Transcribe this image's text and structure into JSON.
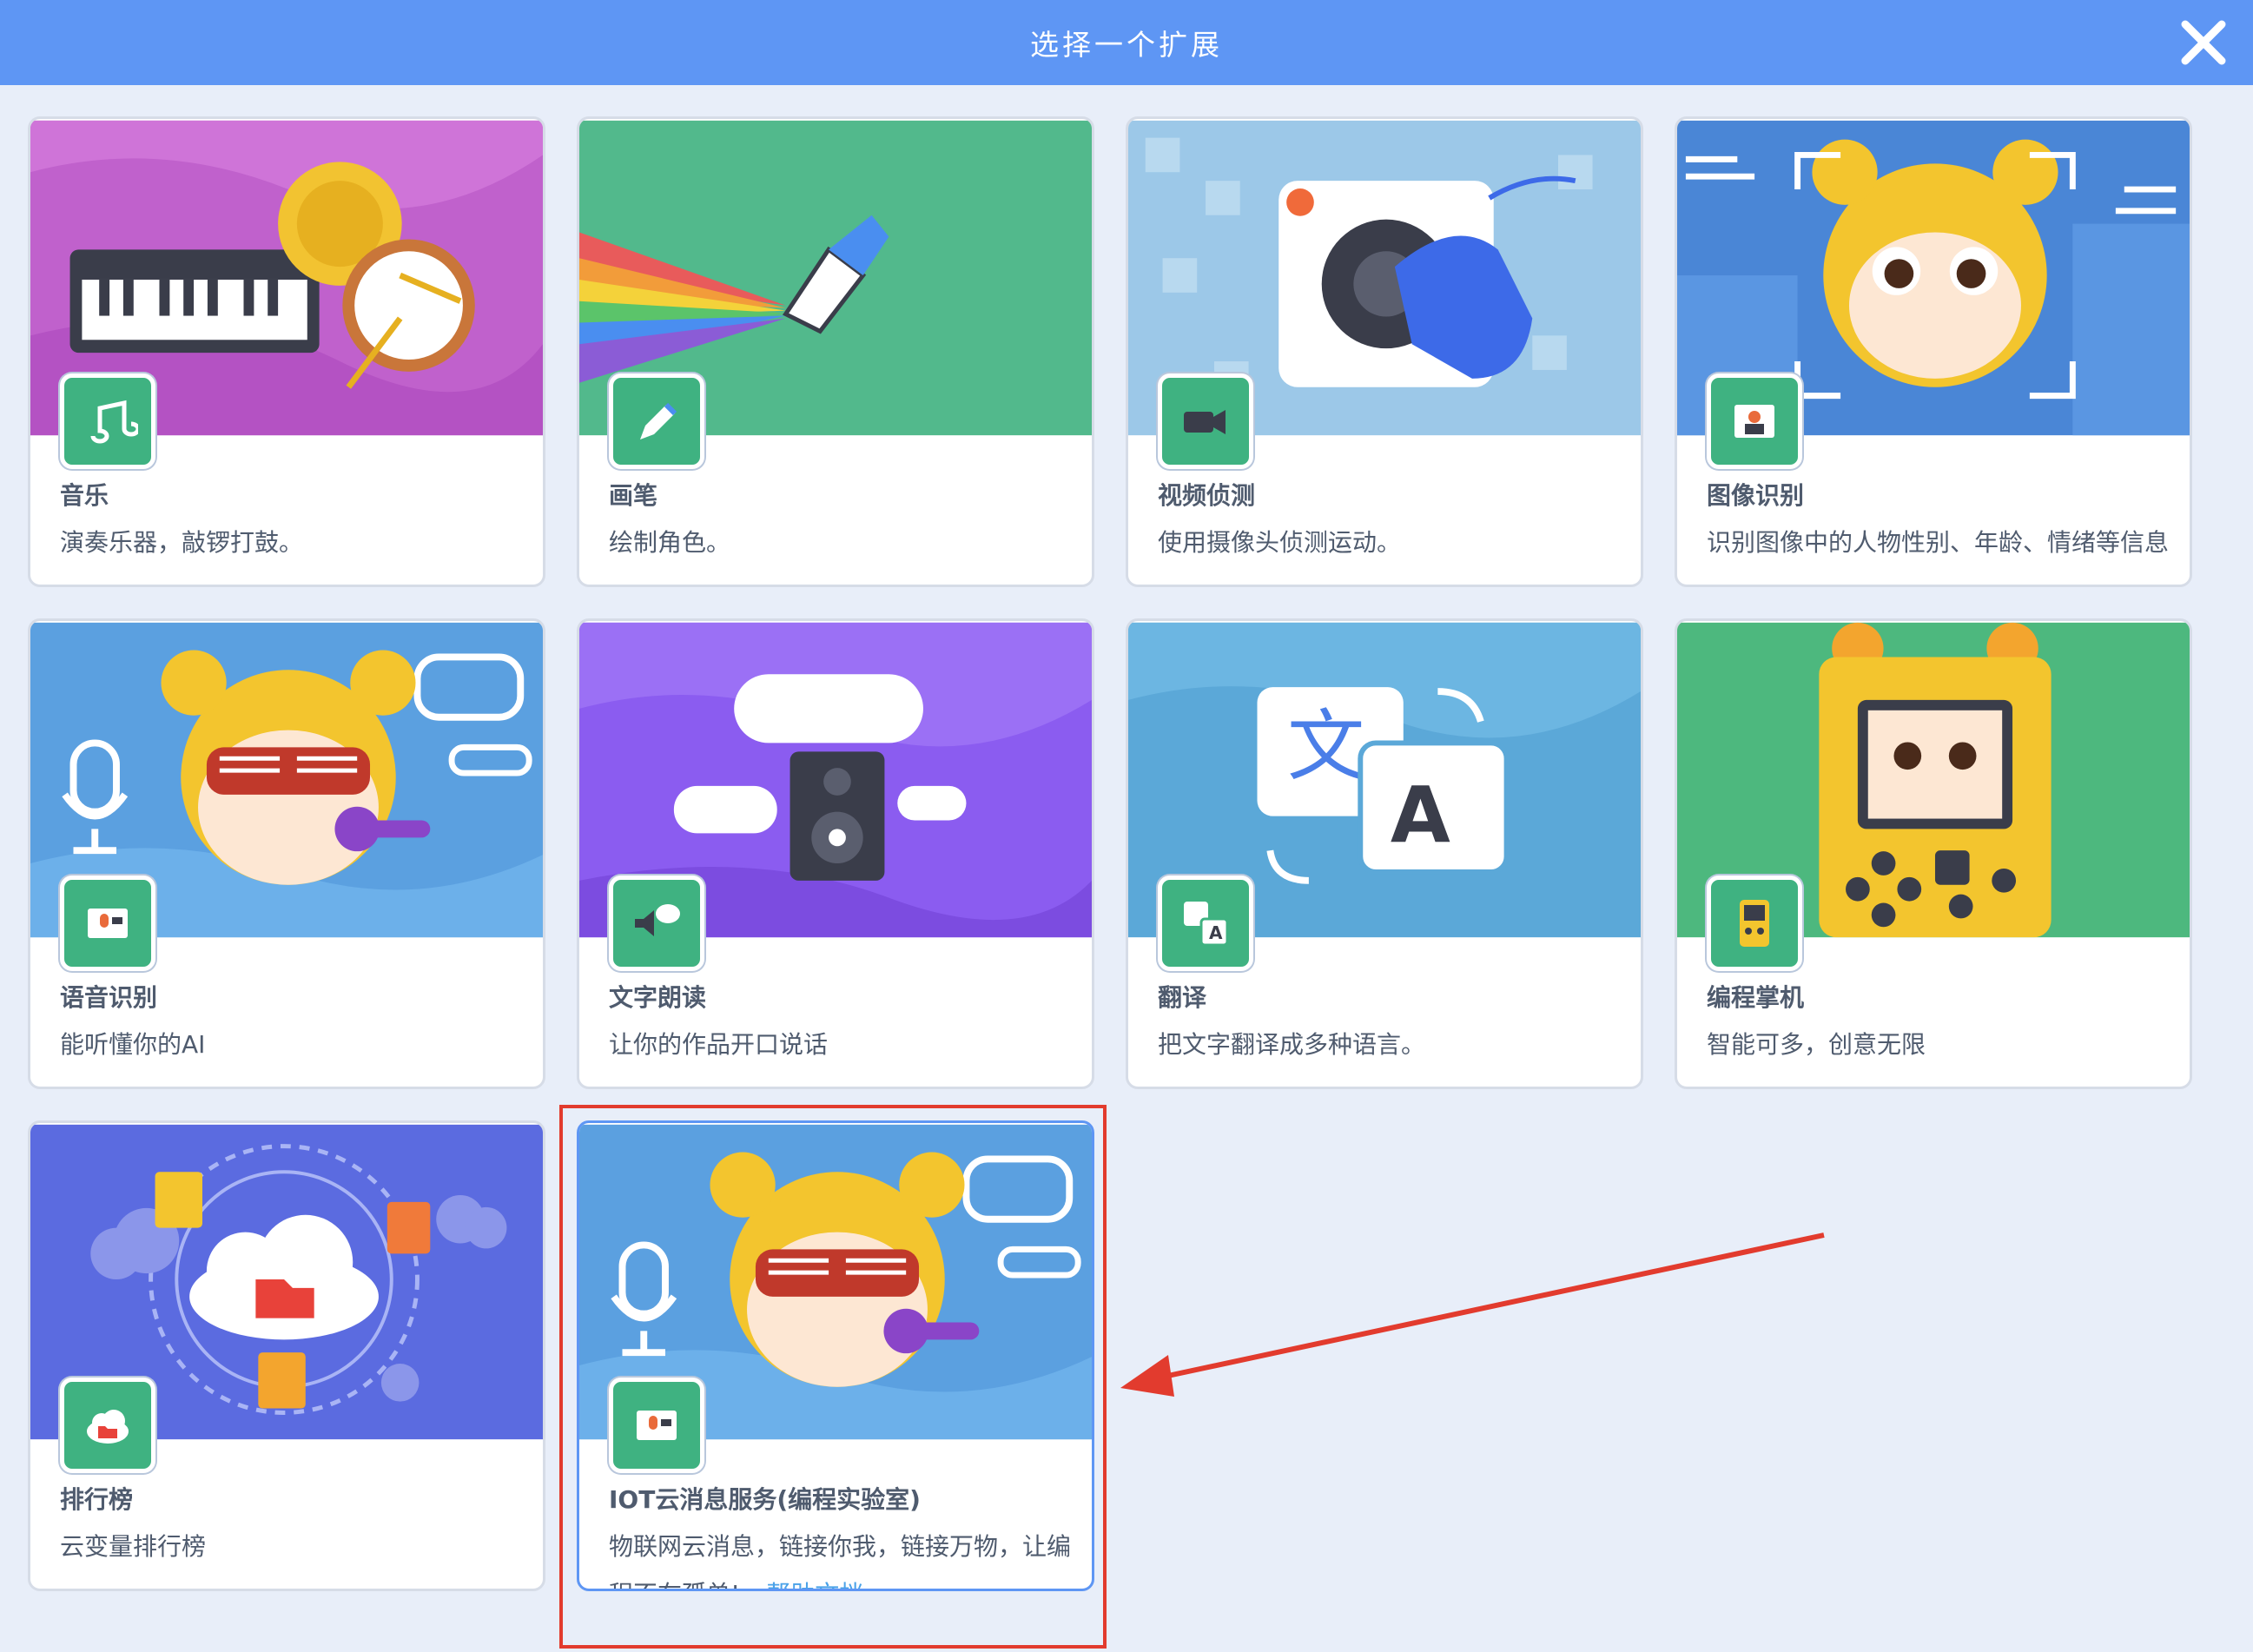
{
  "header": {
    "title": "选择一个扩展"
  },
  "cards": [
    {
      "title": "音乐",
      "desc": "演奏乐器，敲锣打鼓。",
      "icon": "music-notes-icon"
    },
    {
      "title": "画笔",
      "desc": "绘制角色。",
      "icon": "pen-icon"
    },
    {
      "title": "视频侦测",
      "desc": "使用摄像头侦测运动。",
      "icon": "video-camera-icon"
    },
    {
      "title": "图像识别",
      "desc": "识别图像中的人物性别、年龄、情绪等信息",
      "icon": "image-recognition-icon"
    },
    {
      "title": "语音识别",
      "desc": "能听懂你的AI",
      "icon": "voice-recognition-icon"
    },
    {
      "title": "文字朗读",
      "desc": "让你的作品开口说话",
      "icon": "speaker-bubble-icon"
    },
    {
      "title": "翻译",
      "desc": "把文字翻译成多种语言。",
      "icon": "translate-icon"
    },
    {
      "title": "编程掌机",
      "desc": "智能可多，创意无限",
      "icon": "handheld-console-icon"
    },
    {
      "title": "排行榜",
      "desc": "云变量排行榜",
      "icon": "cloud-folder-icon"
    },
    {
      "title": "IOT云消息服务(编程实验室)",
      "desc": "物联网云消息，链接你我，链接万物，让编程不在孤单!",
      "link": "帮助文档",
      "icon": "voice-recognition-icon"
    }
  ],
  "colors": {
    "header": "#5e96f4",
    "background": "#e8eef9",
    "icon_tile": "#3fb281",
    "highlight": "#e23b2e",
    "link": "#4aa2e8"
  }
}
